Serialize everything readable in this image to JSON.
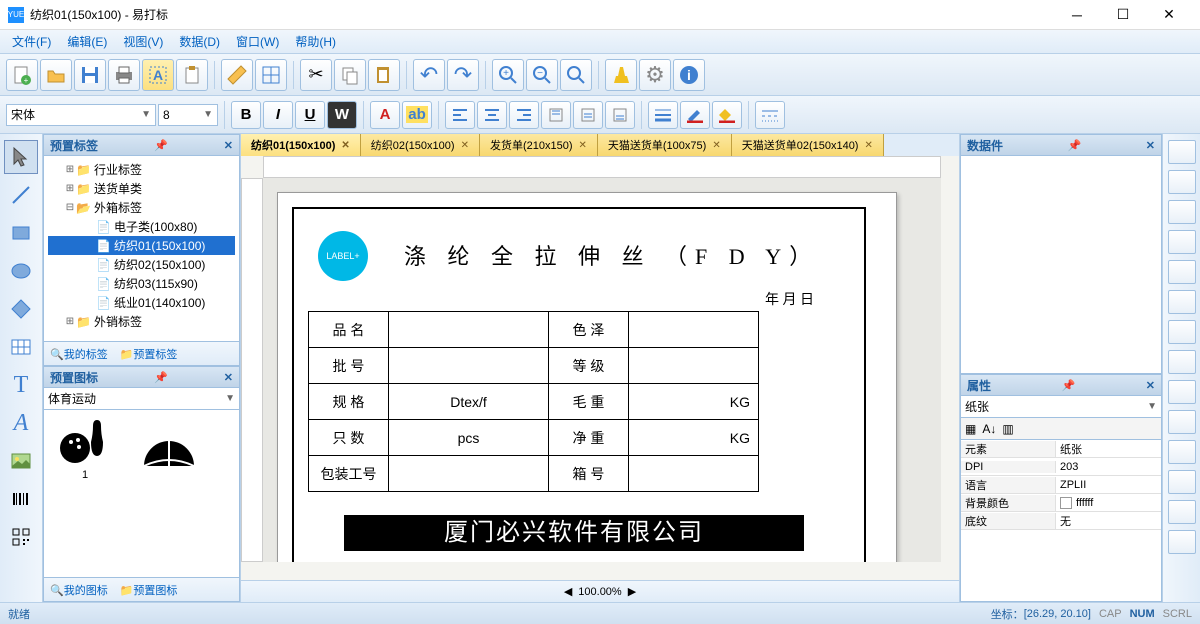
{
  "window": {
    "title": "纺织01(150x100) - 易打标",
    "app_icon": "YUE"
  },
  "menu": {
    "file": "文件(F)",
    "edit": "编辑(E)",
    "view": "视图(V)",
    "data": "数据(D)",
    "window": "窗口(W)",
    "help": "帮助(H)"
  },
  "format": {
    "font_family": "宋体",
    "font_size": "8"
  },
  "panels": {
    "preset_labels": "预置标签",
    "preset_icons": "预置图标",
    "icon_category": "体育运动",
    "data_pieces": "数据件",
    "properties": "属性",
    "my_labels": "我的标签",
    "preset_labels_link": "预置标签",
    "my_icons": "我的图标",
    "preset_icons_link": "预置图标"
  },
  "tree": {
    "n0": "行业标签",
    "n1": "送货单类",
    "n2": "外箱标签",
    "n2a": "电子类(100x80)",
    "n2b": "纺织01(150x100)",
    "n2c": "纺织02(150x100)",
    "n2d": "纺织03(115x90)",
    "n2e": "纸业01(140x100)",
    "n3": "外销标签"
  },
  "icon_caption_1": "1",
  "tabs": [
    {
      "label": "纺织01(150x100)"
    },
    {
      "label": "纺织02(150x100)"
    },
    {
      "label": "发货单(210x150)"
    },
    {
      "label": "天猫送货单(100x75)"
    },
    {
      "label": "天猫送货单02(150x140)"
    }
  ],
  "label": {
    "logo": "LABEL+",
    "title": "涤 纶 全 拉 伸 丝  （F D Y）",
    "date": "年    月    日",
    "r1a": "品 名",
    "r1b": "色 泽",
    "r2a": "批 号",
    "r2b": "等 级",
    "r3a": "规 格",
    "r3av": "Dtex/f",
    "r3b": "毛 重",
    "r3bv": "KG",
    "r4a": "只 数",
    "r4av": "pcs",
    "r4b": "净 重",
    "r4bv": "KG",
    "r5a": "包装工号",
    "r5b": "箱 号",
    "footer": "厦门必兴软件有限公司"
  },
  "zoom": "100.00%",
  "props": {
    "selector": "纸张",
    "element_k": "元素",
    "element_v": "纸张",
    "dpi_k": "DPI",
    "dpi_v": "203",
    "lang_k": "语言",
    "lang_v": "ZPLII",
    "bg_k": "背景颜色",
    "bg_v": "ffffff",
    "tex_k": "底纹",
    "tex_v": "无"
  },
  "status": {
    "ready": "就绪",
    "coord_label": "坐标：",
    "coord_value": "[26.29, 20.10]",
    "cap": "CAP",
    "num": "NUM",
    "scrl": "SCRL"
  }
}
